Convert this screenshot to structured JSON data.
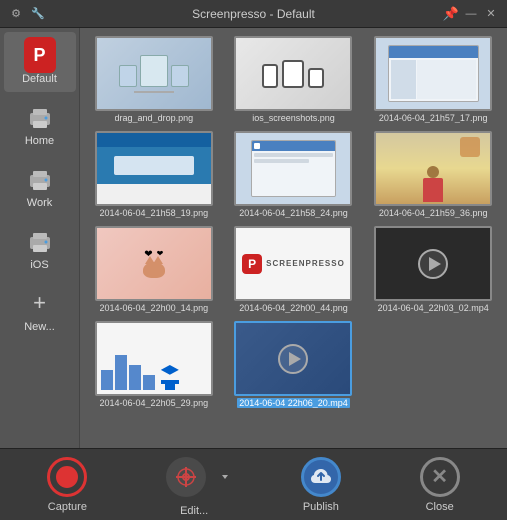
{
  "titleBar": {
    "title": "Screenpresso  -  Default",
    "pinLabel": "📌",
    "minimizeLabel": "_",
    "closeLabel": "✕"
  },
  "sidebar": {
    "items": [
      {
        "id": "default",
        "label": "Default",
        "icon": "default",
        "active": true
      },
      {
        "id": "home",
        "label": "Home",
        "icon": "printer"
      },
      {
        "id": "work",
        "label": "Work",
        "icon": "printer"
      },
      {
        "id": "ios",
        "label": "iOS",
        "icon": "printer"
      },
      {
        "id": "new",
        "label": "New...",
        "icon": "plus"
      }
    ]
  },
  "thumbnails": [
    {
      "id": "t1",
      "filename": "drag_and_drop.png",
      "type": "drag_drop",
      "selected": false
    },
    {
      "id": "t2",
      "filename": "ios_screenshots.png",
      "type": "ios",
      "selected": false
    },
    {
      "id": "t3",
      "filename": "2014-06-04_21h57_17.png",
      "type": "screenshot_laptop",
      "selected": false
    },
    {
      "id": "t4",
      "filename": "2014-06-04_21h58_19.png",
      "type": "blue_ui",
      "selected": false
    },
    {
      "id": "t5",
      "filename": "2014-06-04_21h58_24.png",
      "type": "blue_dialog",
      "selected": false
    },
    {
      "id": "t6",
      "filename": "2014-06-04_21h59_36.png",
      "type": "person",
      "selected": false
    },
    {
      "id": "t7",
      "filename": "2014-06-04_22h00_14.png",
      "type": "cat_hearts",
      "selected": false
    },
    {
      "id": "t8",
      "filename": "2014-06-04_22h00_44.png",
      "type": "screenpresso_logo",
      "selected": false
    },
    {
      "id": "t9",
      "filename": "2014-06-04_22h03_02.mp4",
      "type": "video",
      "selected": false
    },
    {
      "id": "t10",
      "filename": "2014-06-04_22h05_29.png",
      "type": "chart_dropbox",
      "selected": false
    },
    {
      "id": "t11",
      "filename": "2014-06-04 22h06_20.mp4",
      "type": "video2",
      "selected": true
    }
  ],
  "toolbar": {
    "captureLabel": "Capture",
    "editLabel": "Edit...",
    "publishLabel": "Publish",
    "closeLabel": "Close"
  }
}
